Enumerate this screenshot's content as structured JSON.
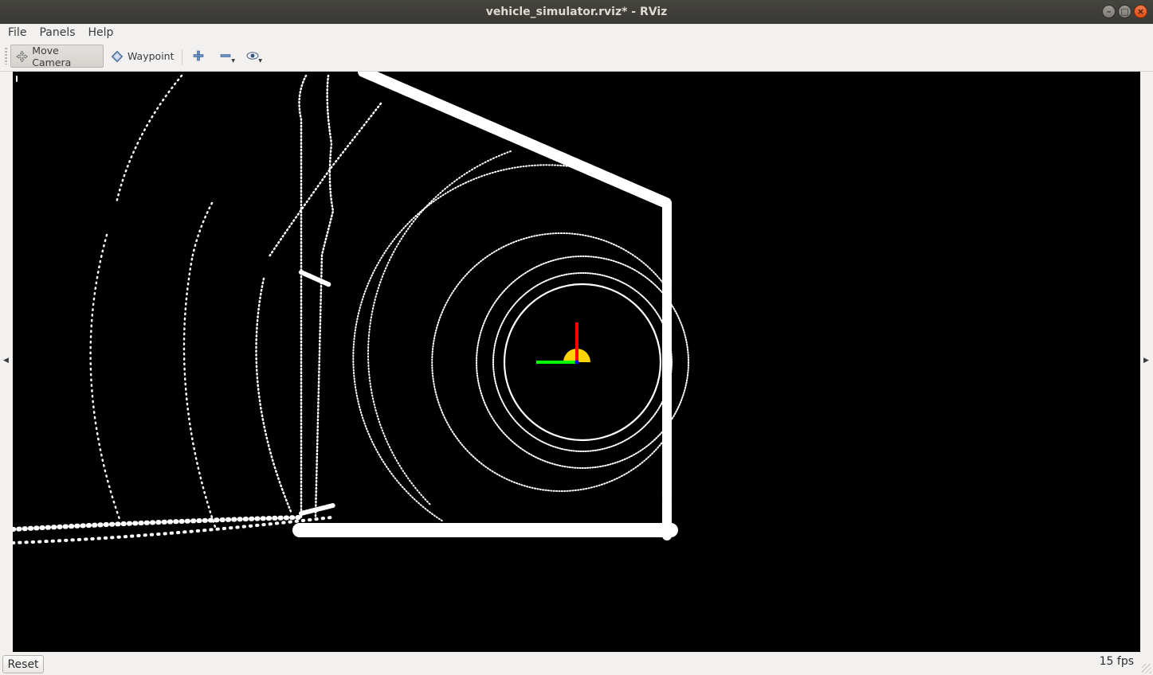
{
  "window": {
    "title": "vehicle_simulator.rviz* - RViz"
  },
  "menu": {
    "items": [
      "File",
      "Panels",
      "Help"
    ]
  },
  "toolbar": {
    "move_camera_label": "Move Camera",
    "waypoint_label": "Waypoint",
    "icons": [
      "move-camera-icon",
      "waypoint-icon",
      "add-tool-icon",
      "remove-tool-icon",
      "view-icon"
    ]
  },
  "viewport": {
    "background": "#000000",
    "points_color": "#ffffff",
    "axis_colors": {
      "x": "#ff0000",
      "y": "#00ff00",
      "z": "#0000ff"
    },
    "vehicle_marker_color": "#ffd400"
  },
  "status": {
    "reset_label": "Reset",
    "fps": "15 fps"
  }
}
